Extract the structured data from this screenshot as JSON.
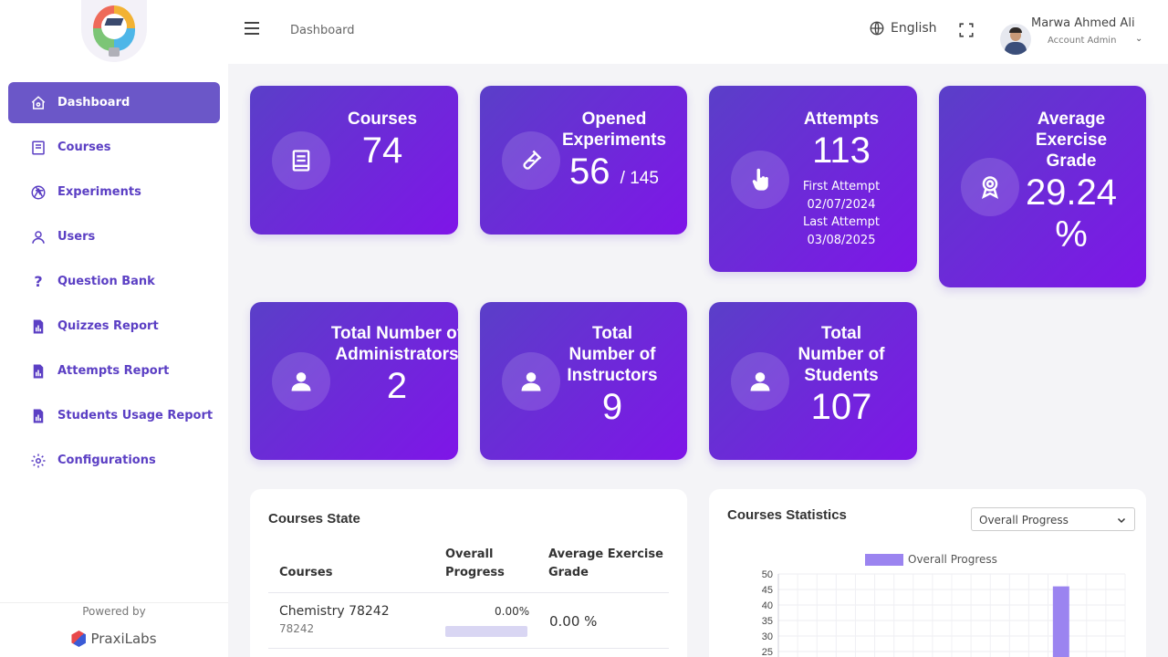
{
  "header": {
    "breadcrumb": "Dashboard",
    "language": "English",
    "user_name": "Marwa Ahmed Ali",
    "user_role": "Account Admin"
  },
  "sidebar": {
    "items": [
      {
        "label": "Dashboard",
        "icon": "home-icon",
        "active": true
      },
      {
        "label": "Courses",
        "icon": "book-icon",
        "active": false
      },
      {
        "label": "Experiments",
        "icon": "aperture-icon",
        "active": false
      },
      {
        "label": "Users",
        "icon": "user-icon",
        "active": false
      },
      {
        "label": "Question Bank",
        "icon": "question-icon",
        "active": false
      },
      {
        "label": "Quizzes Report",
        "icon": "report-icon",
        "active": false
      },
      {
        "label": "Attempts Report",
        "icon": "report-icon",
        "active": false
      },
      {
        "label": "Students Usage Report",
        "icon": "report-icon",
        "active": false
      },
      {
        "label": "Configurations",
        "icon": "gear-icon",
        "active": false
      }
    ],
    "powered_by": "Powered by",
    "brand": "PraxiLabs"
  },
  "stats": {
    "courses": {
      "title": "Courses",
      "value": "74"
    },
    "experiments": {
      "title": "Opened Experiments",
      "value": "56",
      "total": "/ 145"
    },
    "attempts": {
      "title": "Attempts",
      "value": "113",
      "first_label": "First Attempt",
      "first_date": "02/07/2024",
      "last_label": "Last Attempt",
      "last_date": "03/08/2025"
    },
    "grade": {
      "title": "Average Exercise Grade",
      "value": "29.24",
      "unit": "%"
    },
    "administrators": {
      "title": "Total Number of Administrators",
      "value": "2"
    },
    "instructors": {
      "title": "Total Number of Instructors",
      "value": "9"
    },
    "students": {
      "title": "Total Number of Students",
      "value": "107"
    }
  },
  "courses_state": {
    "title": "Courses State",
    "columns": [
      "Courses",
      "Overall Progress",
      "Average Exercise Grade"
    ],
    "rows": [
      {
        "name": "Chemistry 78242",
        "code": "78242",
        "progress": "0.00%",
        "progress_value": 0,
        "grade": "0.00 %"
      }
    ]
  },
  "courses_statistics": {
    "title": "Courses Statistics",
    "selected": "Overall Progress"
  },
  "chart_data": {
    "type": "bar",
    "legend": [
      "Overall Progress"
    ],
    "color": "#9b84f0",
    "ylim": [
      0,
      50
    ],
    "yticks": [
      "50",
      "45",
      "40",
      "35",
      "30",
      "25"
    ],
    "series": [
      {
        "name": "Overall Progress",
        "visible_bars": [
          {
            "value": 46,
            "slot": 14
          }
        ]
      }
    ],
    "slots": 18
  }
}
